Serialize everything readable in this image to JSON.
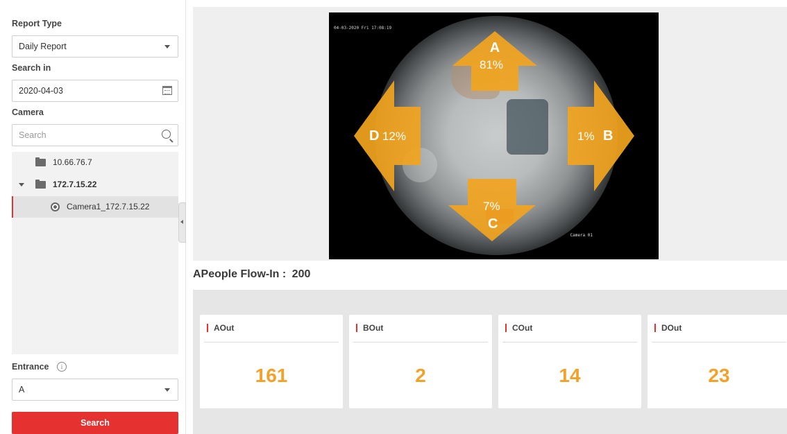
{
  "filters": {
    "report_type_label": "Report Type",
    "report_type_value": "Daily Report",
    "search_in_label": "Search in",
    "date_value": "2020-04-03",
    "camera_label": "Camera",
    "camera_search_placeholder": "Search",
    "entrance_label": "Entrance",
    "entrance_value": "A",
    "search_button": "Search"
  },
  "tree": {
    "items": [
      {
        "label": "10.66.76.7",
        "type": "device"
      },
      {
        "label": "172.7.15.22",
        "type": "device",
        "expanded": true
      },
      {
        "label": "Camera1_172.7.15.22",
        "type": "camera",
        "selected": true
      }
    ]
  },
  "preview": {
    "timestamp": "04-03-2020 Fri 17:08:19",
    "camera_name": "Camera 01",
    "directions": {
      "A": {
        "letter": "A",
        "percent": "81%"
      },
      "B": {
        "letter": "B",
        "percent": "1%"
      },
      "C": {
        "letter": "C",
        "percent": "7%"
      },
      "D": {
        "letter": "D",
        "percent": "12%"
      }
    }
  },
  "flow": {
    "title": "APeople Flow-In :",
    "value": "200"
  },
  "cards": [
    {
      "label": "AOut",
      "value": "161"
    },
    {
      "label": "BOut",
      "value": "2"
    },
    {
      "label": "COut",
      "value": "14"
    },
    {
      "label": "DOut",
      "value": "23"
    }
  ],
  "colors": {
    "accent_red": "#e5312f",
    "value_orange": "#f0a22a",
    "arrow_orange": "#f2a51f"
  }
}
